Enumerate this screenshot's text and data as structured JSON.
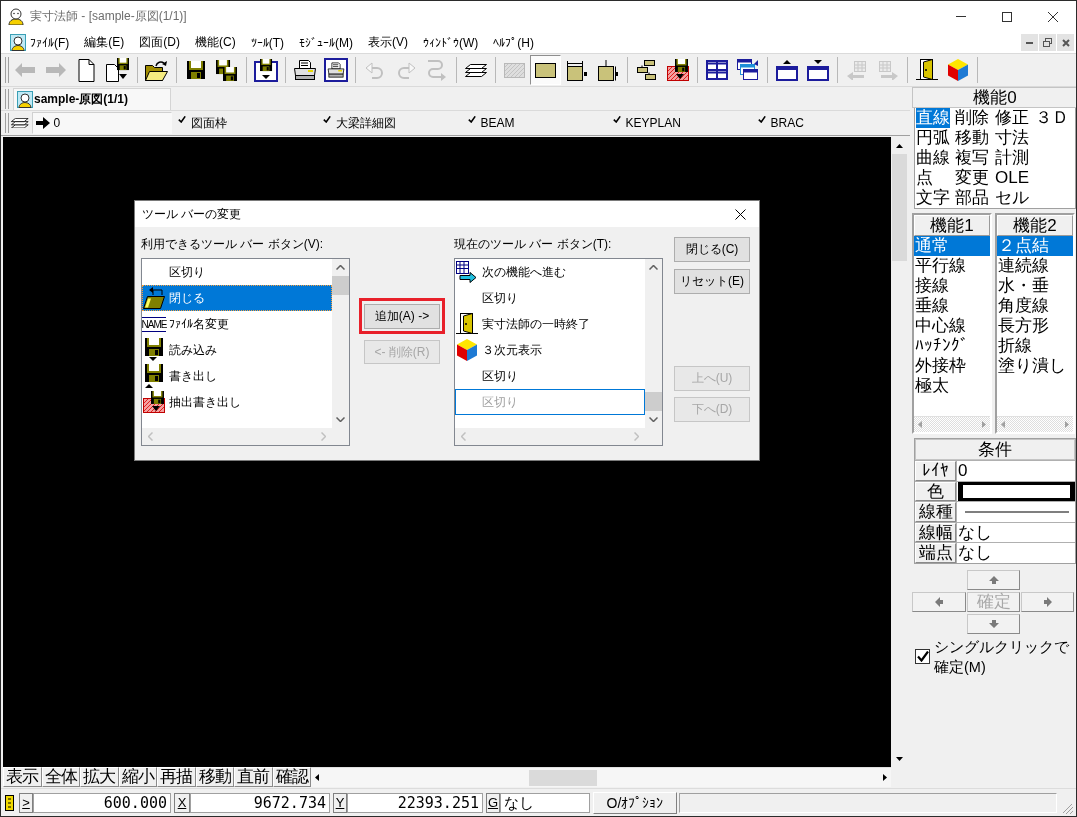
{
  "window": {
    "title": "実寸法師 - [sample-原図(1/1)]"
  },
  "menu": [
    "ﾌｧｲﾙ(F)",
    "編集(E)",
    "図面(D)",
    "機能(C)",
    "ﾂｰﾙ(T)",
    "ﾓｼﾞｭｰﾙ(M)",
    "表示(V)",
    "ｳｨﾝﾄﾞｳ(W)",
    "ﾍﾙﾌﾟ(H)"
  ],
  "toolbar": [
    {
      "disabled": true,
      "pressed": false
    },
    {
      "disabled": true,
      "pressed": false
    },
    {
      "disabled": false,
      "pressed": false
    },
    {
      "disabled": false,
      "pressed": false
    },
    {
      "disabled": false,
      "pressed": false
    },
    {
      "disabled": false,
      "pressed": false
    },
    {
      "disabled": false,
      "pressed": false
    },
    {
      "disabled": false,
      "pressed": false
    },
    {
      "disabled": false,
      "pressed": false
    },
    {
      "disabled": false,
      "pressed": false
    },
    {
      "disabled": true,
      "pressed": false
    },
    {
      "disabled": true,
      "pressed": false
    },
    {
      "disabled": true,
      "pressed": false
    },
    {
      "disabled": false,
      "pressed": false
    },
    {
      "disabled": true,
      "pressed": false
    },
    {
      "disabled": false,
      "pressed": true
    },
    {
      "disabled": false,
      "pressed": false
    },
    {
      "disabled": false,
      "pressed": false
    },
    {
      "disabled": false,
      "pressed": false
    },
    {
      "disabled": false,
      "pressed": false
    },
    {
      "disabled": false,
      "pressed": false
    },
    {
      "disabled": false,
      "pressed": false
    },
    {
      "disabled": false,
      "pressed": false
    },
    {
      "disabled": false,
      "pressed": false
    },
    {
      "disabled": true,
      "pressed": false
    },
    {
      "disabled": true,
      "pressed": false
    },
    {
      "disabled": false,
      "pressed": false
    },
    {
      "disabled": false,
      "pressed": false
    }
  ],
  "document_tabs": [
    {
      "label": "sample-原図(1/1)",
      "selected": true
    }
  ],
  "layers": {
    "current": "0",
    "items": [
      {
        "label": "図面枠",
        "checked": true
      },
      {
        "label": "大梁詳細図",
        "checked": true
      },
      {
        "label": "BEAM",
        "checked": true
      },
      {
        "label": "KEYPLAN",
        "checked": true
      },
      {
        "label": "BRAC",
        "checked": true
      }
    ]
  },
  "command_buttons": [
    "表示",
    "全体",
    "拡大",
    "縮小",
    "再描",
    "移動",
    "直前",
    "確認"
  ],
  "status_bar": {
    "fields": [
      {
        "key": ">",
        "kind": "number",
        "value": "600.000"
      },
      {
        "key": "X",
        "kind": "number",
        "value": "9672.734"
      },
      {
        "key": "Y",
        "kind": "number",
        "value": "22393.251"
      },
      {
        "key": "G",
        "kind": "text",
        "value": "なし"
      }
    ],
    "option_button": "O/ｵﾌﾟｼｮﾝ"
  },
  "function_panels": [
    {
      "kind": "grid",
      "title": "機能0",
      "items": [
        {
          "label": "直線",
          "selected": true
        },
        {
          "label": "円弧",
          "selected": false
        },
        {
          "label": "曲線",
          "selected": false
        },
        {
          "label": "点",
          "selected": false
        },
        {
          "label": "文字",
          "selected": false
        },
        {
          "label": "削除",
          "selected": false
        },
        {
          "label": "移動",
          "selected": false
        },
        {
          "label": "複写",
          "selected": false
        },
        {
          "label": "変更",
          "selected": false
        },
        {
          "label": "部品",
          "selected": false
        },
        {
          "label": "修正",
          "selected": false
        },
        {
          "label": "寸法",
          "selected": false
        },
        {
          "label": "計測",
          "selected": false
        },
        {
          "label": "OLE",
          "selected": false
        },
        {
          "label": "セル",
          "selected": false
        },
        {
          "label": "３Ｄ",
          "selected": false
        }
      ]
    },
    {
      "kind": "list",
      "title": "機能1",
      "items": [
        {
          "label": "通常",
          "selected": true
        },
        {
          "label": "平行線",
          "selected": false
        },
        {
          "label": "接線",
          "selected": false
        },
        {
          "label": "垂線",
          "selected": false
        },
        {
          "label": "中心線",
          "selected": false
        },
        {
          "label": "ﾊｯﾁﾝｸﾞ",
          "selected": false
        },
        {
          "label": "外接枠",
          "selected": false
        },
        {
          "label": "極太",
          "selected": false
        }
      ]
    },
    {
      "kind": "list",
      "title": "機能2",
      "items": [
        {
          "label": "２点結",
          "selected": true
        },
        {
          "label": "連続線",
          "selected": false
        },
        {
          "label": "水・垂",
          "selected": false
        },
        {
          "label": "角度線",
          "selected": false
        },
        {
          "label": "長方形",
          "selected": false
        },
        {
          "label": "折線",
          "selected": false
        },
        {
          "label": "塗り潰し",
          "selected": false
        }
      ]
    }
  ],
  "conditions": {
    "title": "条件",
    "rows": [
      {
        "label": "ﾚｲﾔ",
        "kind": "text",
        "value": "0"
      },
      {
        "label": "色",
        "kind": "color",
        "color": "#ffffff"
      },
      {
        "label": "線種",
        "kind": "line"
      },
      {
        "label": "線幅",
        "kind": "text",
        "value": "なし"
      },
      {
        "label": "端点",
        "kind": "text",
        "value": "なし"
      }
    ]
  },
  "confirm_button": {
    "label": "確定",
    "disabled": true
  },
  "single_click_confirm": {
    "label": "シングルクリックで確定(M)",
    "checked": true
  },
  "dialog": {
    "title": "ツール バーの変更",
    "available_label": "利用できるツール バー ボタン(V):",
    "available": [
      {
        "kind": "separator",
        "label": "区切り",
        "selected": false
      },
      {
        "kind": "command",
        "label": "閉じる",
        "selected": true
      },
      {
        "kind": "command",
        "label": "ﾌｧｲﾙ名変更",
        "icon_text": "NAME",
        "selected": false
      },
      {
        "kind": "command",
        "label": "読み込み",
        "selected": false
      },
      {
        "kind": "command",
        "label": "書き出し",
        "selected": false
      },
      {
        "kind": "command",
        "label": "抽出書き出し",
        "selected": false
      }
    ],
    "add_button": {
      "label": "追加(A) ->",
      "highlighted": true,
      "disabled": false
    },
    "remove_button": {
      "label": "<- 削除(R)",
      "disabled": true
    },
    "current_label": "現在のツール バー ボタン(T):",
    "current": [
      {
        "kind": "command",
        "label": "次の機能へ進む",
        "selected": false,
        "focused": false,
        "disabled": false
      },
      {
        "kind": "separator",
        "label": "区切り",
        "selected": false,
        "focused": false,
        "disabled": false
      },
      {
        "kind": "command",
        "label": "実寸法師の一時終了",
        "selected": false,
        "focused": false,
        "disabled": false
      },
      {
        "kind": "command",
        "label": "３次元表示",
        "selected": false,
        "focused": false,
        "disabled": false
      },
      {
        "kind": "separator",
        "label": "区切り",
        "selected": false,
        "focused": false,
        "disabled": false
      },
      {
        "kind": "separator",
        "label": "区切り",
        "selected": false,
        "focused": true,
        "disabled": true
      }
    ],
    "buttons": [
      {
        "label": "閉じる(C)",
        "disabled": false
      },
      {
        "label": "リセット(E)",
        "disabled": false
      },
      {
        "label": "上へ(U)",
        "disabled": true
      },
      {
        "label": "下へ(D)",
        "disabled": true
      }
    ]
  }
}
